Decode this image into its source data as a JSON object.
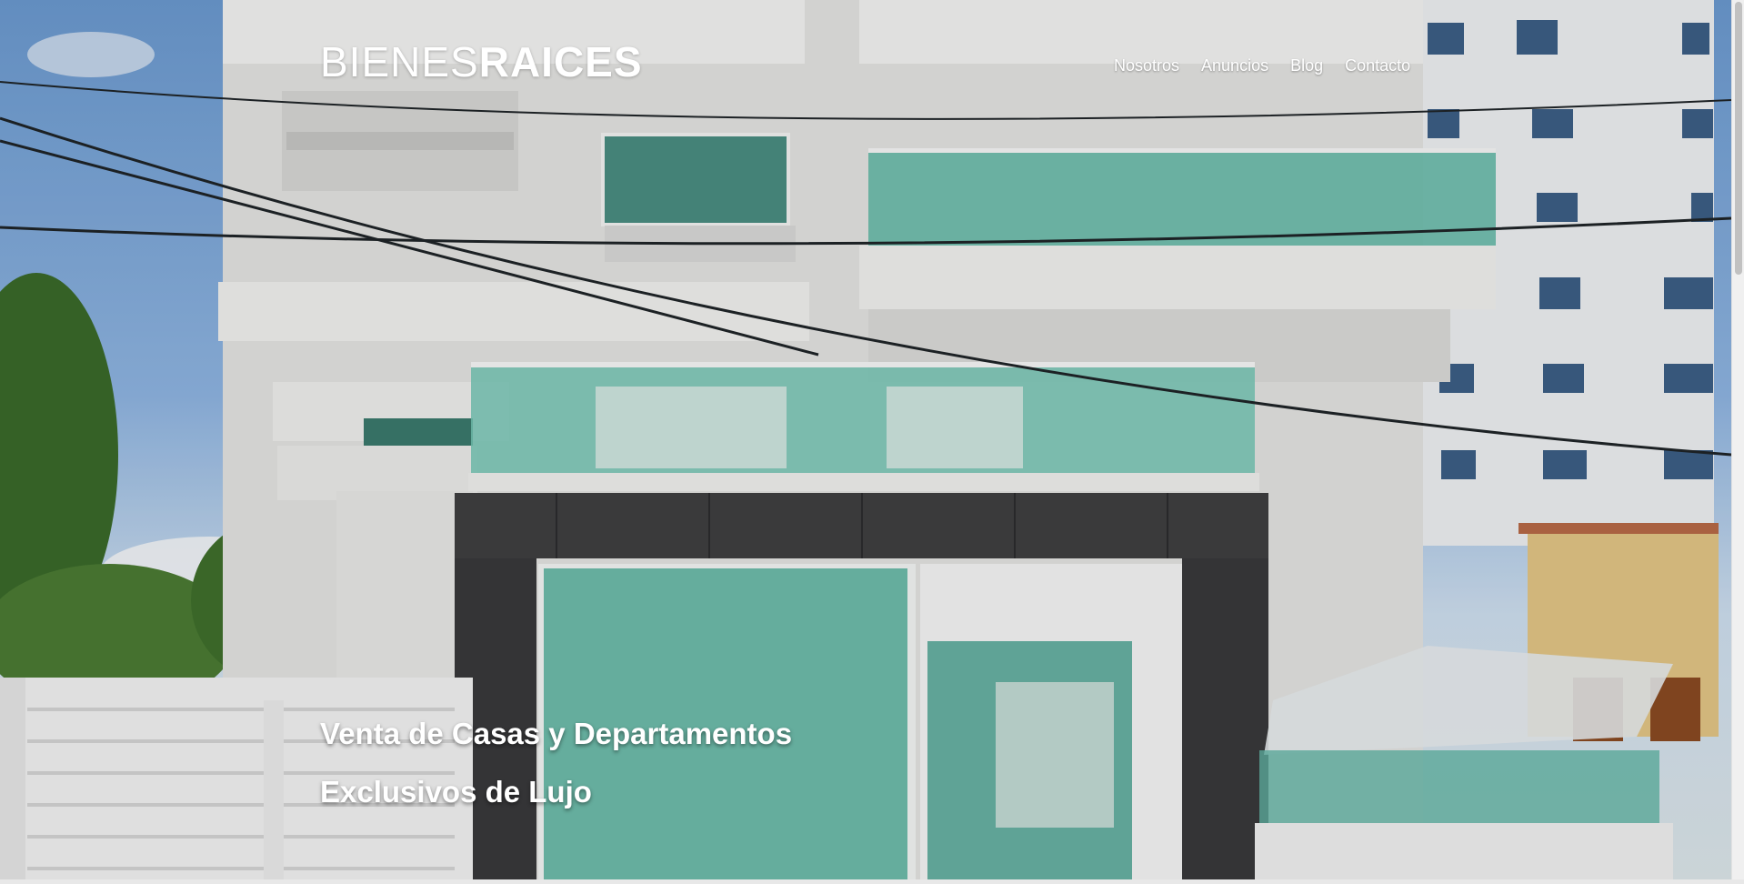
{
  "site": {
    "logo_light": "BIENES",
    "logo_bold": "RAICES"
  },
  "nav": {
    "items": [
      "Nosotros",
      "Anuncios",
      "Blog",
      "Contacto"
    ]
  },
  "hero": {
    "line1": "Venta de Casas y Departamentos",
    "line2": "Exclusivos de Lujo"
  },
  "colors": {
    "text": "#ffffff",
    "glass": "#5fb8a6",
    "sky": "#7ea9dc"
  }
}
